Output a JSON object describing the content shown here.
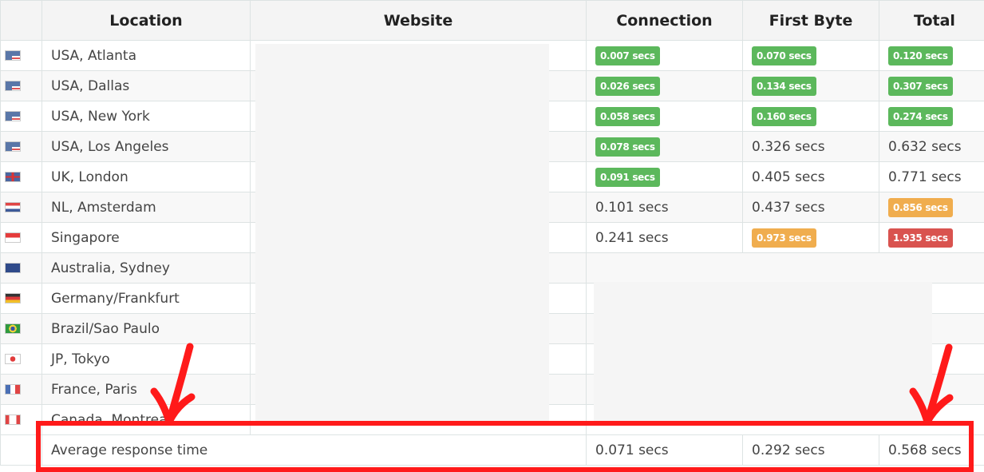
{
  "table": {
    "headers": [
      "",
      "Location",
      "Website",
      "Connection",
      "First Byte",
      "Total"
    ],
    "rows": [
      {
        "flag": "us-flag-icon",
        "location": "USA, Atlanta",
        "connection": {
          "text": "0.007 secs",
          "status": "green"
        },
        "first_byte": {
          "text": "0.070 secs",
          "status": "green"
        },
        "total": {
          "text": "0.120 secs",
          "status": "green"
        }
      },
      {
        "flag": "us-flag-icon",
        "location": "USA, Dallas",
        "connection": {
          "text": "0.026 secs",
          "status": "green"
        },
        "first_byte": {
          "text": "0.134 secs",
          "status": "green"
        },
        "total": {
          "text": "0.307 secs",
          "status": "green"
        }
      },
      {
        "flag": "us-flag-icon",
        "location": "USA, New York",
        "connection": {
          "text": "0.058 secs",
          "status": "green"
        },
        "first_byte": {
          "text": "0.160 secs",
          "status": "green"
        },
        "total": {
          "text": "0.274 secs",
          "status": "green"
        }
      },
      {
        "flag": "us-flag-icon",
        "location": "USA, Los Angeles",
        "connection": {
          "text": "0.078 secs",
          "status": "green"
        },
        "first_byte": {
          "text": "0.326 secs",
          "status": "plain"
        },
        "total": {
          "text": "0.632 secs",
          "status": "plain"
        }
      },
      {
        "flag": "uk-flag-icon",
        "location": "UK, London",
        "connection": {
          "text": "0.091 secs",
          "status": "green"
        },
        "first_byte": {
          "text": "0.405 secs",
          "status": "plain"
        },
        "total": {
          "text": "0.771 secs",
          "status": "plain"
        }
      },
      {
        "flag": "nl-flag-icon",
        "location": "NL, Amsterdam",
        "connection": {
          "text": "0.101 secs",
          "status": "plain"
        },
        "first_byte": {
          "text": "0.437 secs",
          "status": "plain"
        },
        "total": {
          "text": "0.856 secs",
          "status": "orange"
        }
      },
      {
        "flag": "sg-flag-icon",
        "location": "Singapore",
        "connection": {
          "text": "0.241 secs",
          "status": "plain"
        },
        "first_byte": {
          "text": "0.973 secs",
          "status": "orange"
        },
        "total": {
          "text": "1.935 secs",
          "status": "red"
        }
      },
      {
        "flag": "au-flag-icon",
        "location": "Australia, Sydney"
      },
      {
        "flag": "de-flag-icon",
        "location": "Germany/Frankfurt"
      },
      {
        "flag": "br-flag-icon",
        "location": "Brazil/Sao Paulo"
      },
      {
        "flag": "jp-flag-icon",
        "location": "JP, Tokyo"
      },
      {
        "flag": "fr-flag-icon",
        "location": "France, Paris"
      },
      {
        "flag": "ca-flag-icon",
        "location": "Canada, Montreal"
      }
    ],
    "average": {
      "label": "Average response time",
      "connection": "0.071 secs",
      "first_byte": "0.292 secs",
      "total": "0.568 secs"
    }
  },
  "colors": {
    "green": "#5cb85c",
    "orange": "#f0ad4e",
    "red": "#d9534f",
    "annotation": "#ff1a1a"
  }
}
